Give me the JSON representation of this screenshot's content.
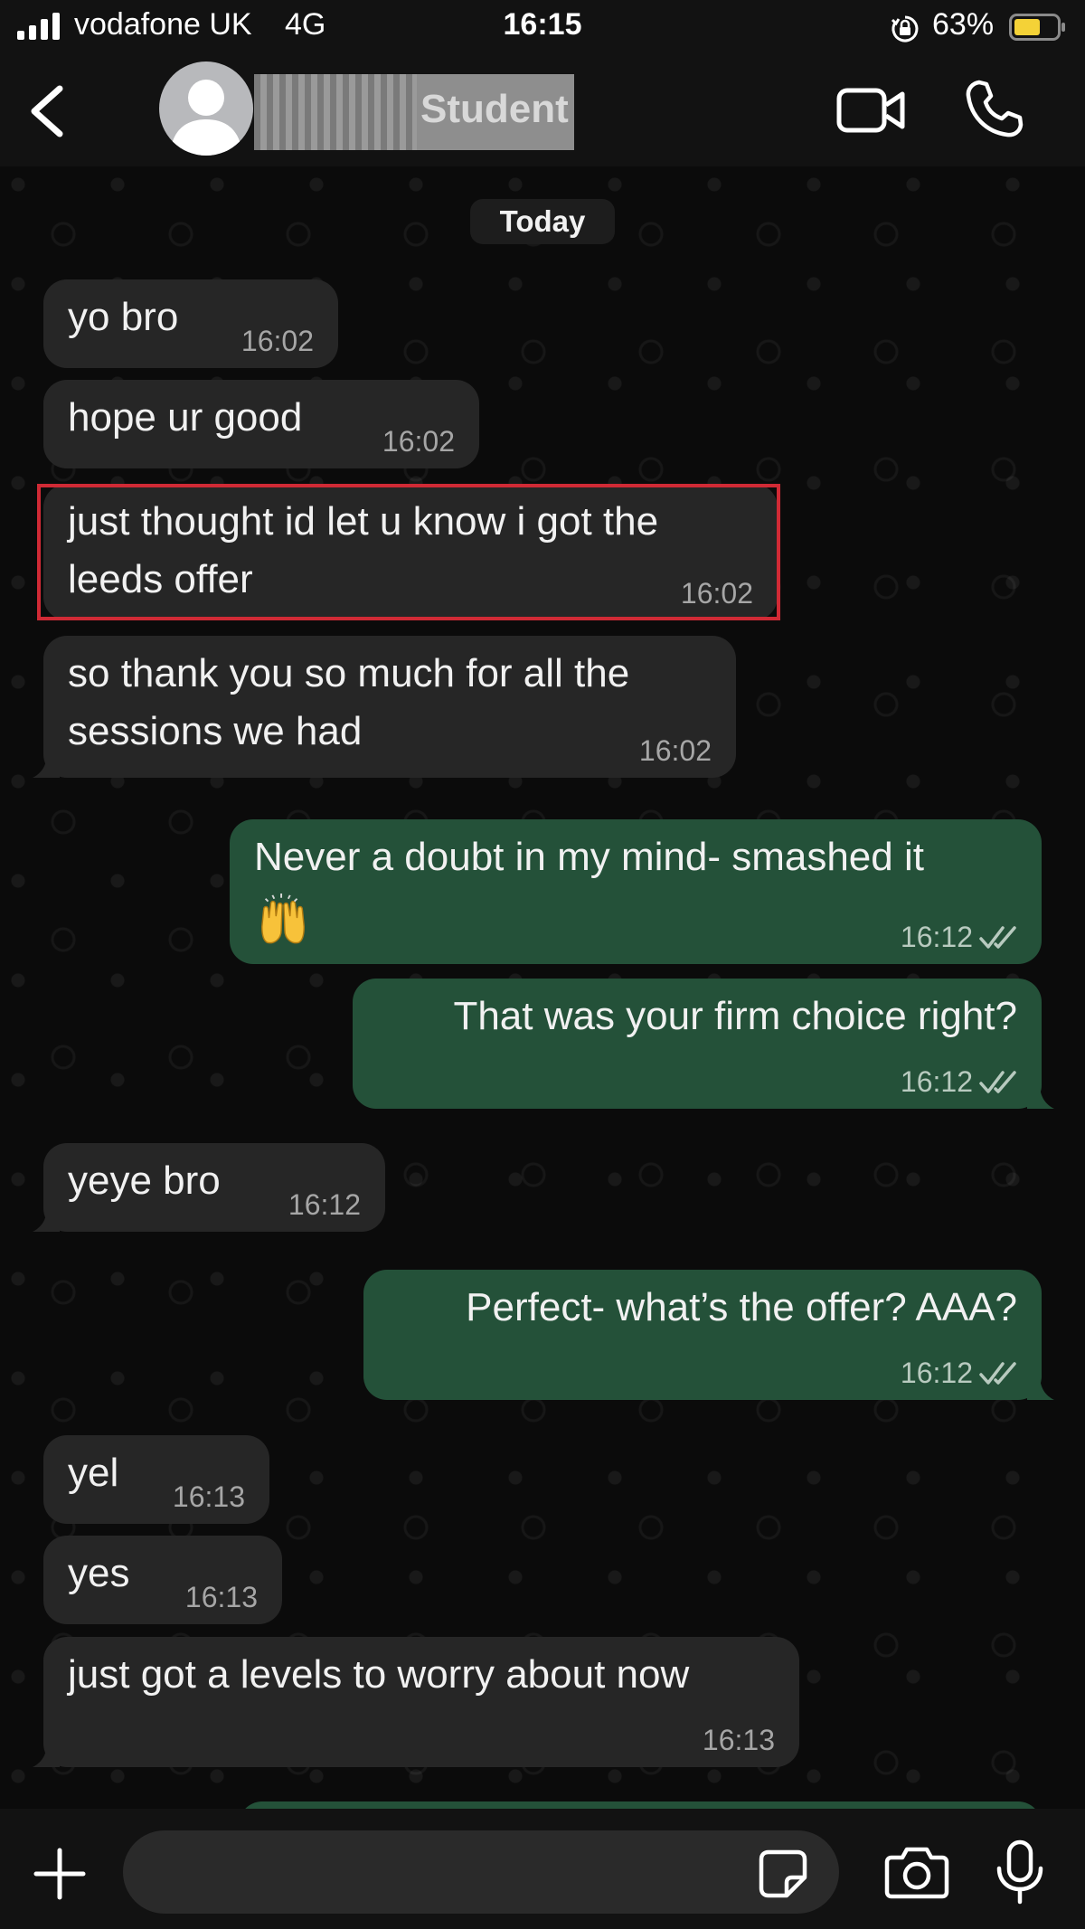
{
  "status_bar": {
    "carrier": "vodafone UK",
    "network": "4G",
    "time": "16:15",
    "battery": "63%",
    "battery_level": 0.63
  },
  "header": {
    "contact_name": "Student"
  },
  "chat": {
    "date_label": "Today",
    "messages": [
      {
        "direction": "in",
        "text": "yo bro",
        "time": "16:02"
      },
      {
        "direction": "in",
        "text": "hope ur good",
        "time": "16:02"
      },
      {
        "direction": "in",
        "text": "just thought id let u know i got the\nleeds offer",
        "time": "16:02"
      },
      {
        "direction": "in",
        "text": "so thank you so much for all the\nsessions we had",
        "time": "16:02"
      },
      {
        "direction": "out",
        "text": "Never a doubt in my mind- smashed it",
        "time": "16:12",
        "emoji": "raising-hands-icon"
      },
      {
        "direction": "out",
        "text": "That was your firm choice right?",
        "time": "16:12"
      },
      {
        "direction": "in",
        "text": "yeye bro",
        "time": "16:12"
      },
      {
        "direction": "out",
        "text": "Perfect- what’s the offer? AAA?",
        "time": "16:12"
      },
      {
        "direction": "in",
        "text": "yel",
        "time": "16:13"
      },
      {
        "direction": "in",
        "text": "yes",
        "time": "16:13"
      },
      {
        "direction": "in",
        "text": "just got a levels to worry about now",
        "time": "16:13"
      }
    ]
  },
  "composer": {
    "placeholder": ""
  },
  "icons": {
    "back": "chevron-left-icon",
    "video": "video-camera-icon",
    "call": "phone-icon",
    "attach": "plus-icon",
    "sticker": "sticker-icon",
    "camera": "camera-icon",
    "mic": "microphone-icon",
    "read": "double-check-icon"
  },
  "colors": {
    "incoming_bubble": "#262626",
    "outgoing_bubble": "#245139",
    "highlight_box": "#d02a35",
    "battery_fill": "#f4d237"
  }
}
